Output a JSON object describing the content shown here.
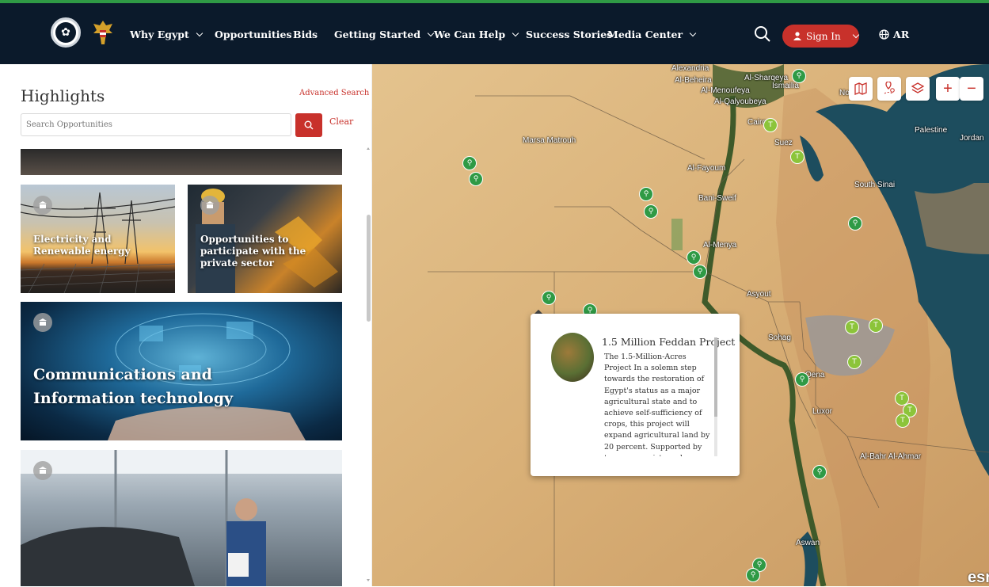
{
  "nav": {
    "items": [
      {
        "label": "Why Egypt",
        "dropdown": true
      },
      {
        "label": "Opportunities",
        "dropdown": false
      },
      {
        "label": "Bids",
        "dropdown": false
      },
      {
        "label": "Getting Started",
        "dropdown": true
      },
      {
        "label": "We Can Help",
        "dropdown": true
      },
      {
        "label": "Success Stories",
        "dropdown": false
      },
      {
        "label": "Media Center",
        "dropdown": true
      }
    ],
    "sign_in": "Sign In",
    "lang": "AR",
    "accent": "#c8312b",
    "bg": "#0b1a2b"
  },
  "panel": {
    "title": "Highlights",
    "advanced_search": "Advanced Search",
    "search_placeholder": "Search Opportunities",
    "clear": "Clear",
    "cards": [
      {
        "title": "Electricity and Renewable energy"
      },
      {
        "title": "Opportunities to participate with the private sector"
      },
      {
        "title": "Communications and Information technology"
      },
      {
        "title": ""
      }
    ]
  },
  "map": {
    "labels": [
      "Alexandria",
      "Al-Beheira",
      "Al-Sharqeya",
      "Ismailia",
      "Al-Menoufeya",
      "Al-Qalyoubeya",
      "Cairo",
      "Suez",
      "Marsa Matrouh",
      "Al-Fayoum",
      "Bani-Sweif",
      "Al-Menya",
      "Asyout",
      "Sohag",
      "Qena",
      "Luxor",
      "Aswan",
      "South Sinai",
      "North Sinai",
      "Palestine",
      "Jordan",
      "Al-Bahr Al-Ahmar"
    ],
    "label_display": [
      "Alexandria",
      "Al-Beheira",
      "Al-Sharqeya",
      "Ismailia",
      "Al-Menoufeya",
      "Al-Qalyoubeya",
      "Cairo",
      "Suez",
      "Marsa Matrouh",
      "Al-Fayoum",
      "Bani-Sweif",
      "Al-Menya",
      "Asyout",
      "Sohag",
      "Qena",
      "Luxor",
      "Aswan",
      "South Sinai",
      "No",
      "Palestine",
      "Jordan",
      "Al-Bahr Al-Ahmar"
    ],
    "zoom_in": "+",
    "zoom_out": "−",
    "attribution": "esri"
  },
  "popup": {
    "title": "1.5 Million Feddan Project",
    "body": "The 1.5-Million-Acres Project In a solemn step towards the restoration of Egypt's status as a major agricultural state and to achieve self-sufficiency of crops, this project will expand agricultural land by 20 percent. Supported by top agronomists and reformists, the project is"
  }
}
